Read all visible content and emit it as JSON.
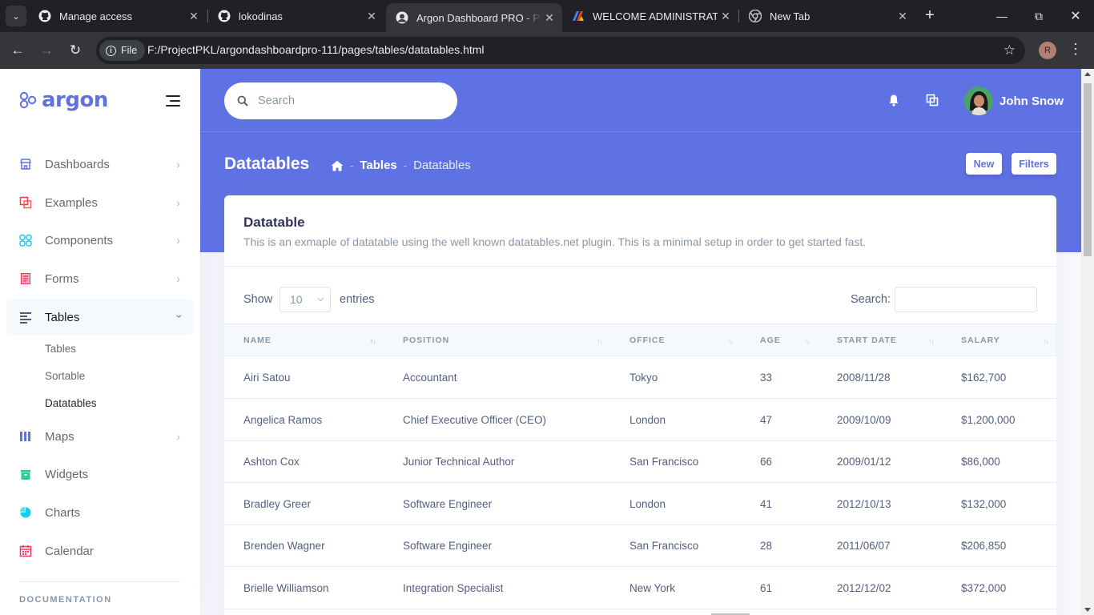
{
  "browser": {
    "tabs": [
      {
        "title": "Manage access",
        "icon": "github-icon"
      },
      {
        "title": "lokodinas",
        "icon": "github-icon"
      },
      {
        "title": "Argon Dashboard PRO - Pre",
        "icon": "argon-avatar-icon",
        "active": true
      },
      {
        "title": "WELCOME ADMINISTRATOR",
        "icon": "app-logo-icon"
      },
      {
        "title": "New Tab",
        "icon": "chrome-icon"
      }
    ],
    "chip_label": "File",
    "url": "F:/ProjectPKL/argondashboardpro-111/pages/tables/datatables.html",
    "profile_initial": "R"
  },
  "sidebar": {
    "brand": "argon",
    "items": [
      {
        "label": "Dashboards",
        "icon": "shop-icon",
        "color": "#5e72e4"
      },
      {
        "label": "Examples",
        "icon": "ungroup-icon",
        "color": "#f5365c"
      },
      {
        "label": "Components",
        "icon": "components-icon",
        "color": "#11cdef"
      },
      {
        "label": "Forms",
        "icon": "single-copy-icon",
        "color": "#f5365c"
      },
      {
        "label": "Tables",
        "icon": "align-left-icon",
        "color": "#172b4d"
      },
      {
        "label": "Maps",
        "icon": "map-big-icon",
        "color": "#5e72e4"
      },
      {
        "label": "Widgets",
        "icon": "archive-icon",
        "color": "#2dce89"
      },
      {
        "label": "Charts",
        "icon": "chart-pie-icon",
        "color": "#11cdef"
      },
      {
        "label": "Calendar",
        "icon": "calendar-icon",
        "color": "#f5365c"
      }
    ],
    "sub_items": [
      "Tables",
      "Sortable",
      "Datatables"
    ],
    "doc_heading": "DOCUMENTATION"
  },
  "header": {
    "search_placeholder": "Search",
    "user_name": "John Snow",
    "page_title": "Datatables",
    "breadcrumb": [
      "Tables",
      "Datatables"
    ],
    "breadcrumb_sep": "-",
    "buttons": {
      "new": "New",
      "filters": "Filters"
    }
  },
  "card": {
    "title": "Datatable",
    "description": "This is an exmaple of datatable using the well known datatables.net plugin. This is a minimal setup in order to get started fast.",
    "show_label": "Show",
    "entries_value": "10",
    "entries_label": "entries",
    "search_label": "Search:"
  },
  "table": {
    "columns": [
      "NAME",
      "POSITION",
      "OFFICE",
      "AGE",
      "START DATE",
      "SALARY"
    ],
    "rows": [
      [
        "Airi Satou",
        "Accountant",
        "Tokyo",
        "33",
        "2008/11/28",
        "$162,700"
      ],
      [
        "Angelica Ramos",
        "Chief Executive Officer (CEO)",
        "London",
        "47",
        "2009/10/09",
        "$1,200,000"
      ],
      [
        "Ashton Cox",
        "Junior Technical Author",
        "San Francisco",
        "66",
        "2009/01/12",
        "$86,000"
      ],
      [
        "Bradley Greer",
        "Software Engineer",
        "London",
        "41",
        "2012/10/13",
        "$132,000"
      ],
      [
        "Brenden Wagner",
        "Software Engineer",
        "San Francisco",
        "28",
        "2011/06/07",
        "$206,850"
      ],
      [
        "Brielle Williamson",
        "Integration Specialist",
        "New York",
        "61",
        "2012/12/02",
        "$372,000"
      ]
    ]
  },
  "colors": {
    "primary": "#5e72e4",
    "text": "#525f7f",
    "muted": "#8898aa",
    "heading": "#32325d"
  }
}
